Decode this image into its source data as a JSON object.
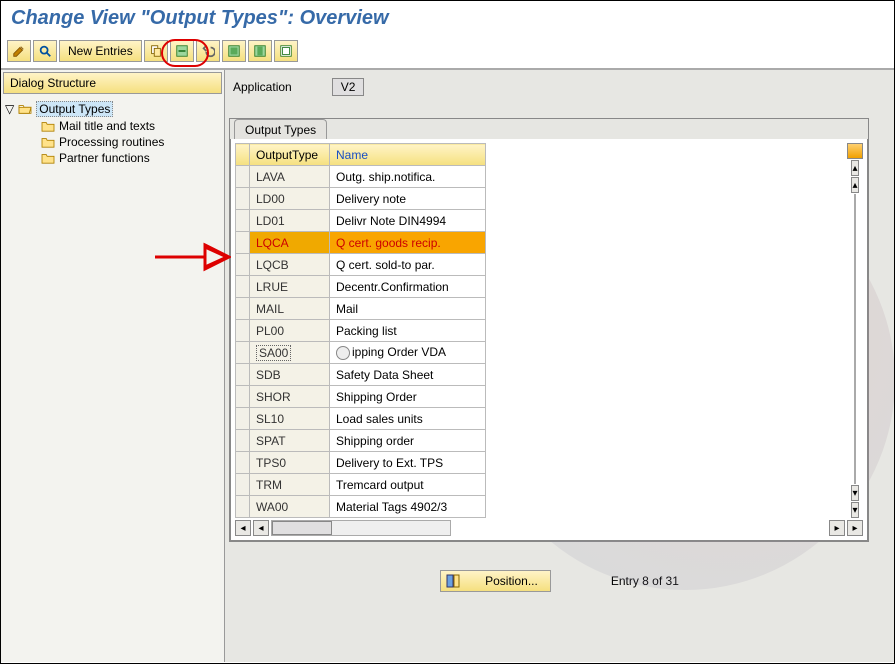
{
  "title": "Change View \"Output Types\": Overview",
  "toolbar": {
    "new_entries": "New Entries"
  },
  "sidebar": {
    "header": "Dialog Structure",
    "root": "Output Types",
    "children": [
      "Mail title and texts",
      "Processing routines",
      "Partner functions"
    ]
  },
  "app": {
    "label": "Application",
    "value": "V2"
  },
  "table": {
    "tab": "Output Types",
    "col1": "OutputType",
    "col2": "Name",
    "rows": [
      {
        "code": "LAVA",
        "name": "Outg. ship.notifica."
      },
      {
        "code": "LD00",
        "name": "Delivery note"
      },
      {
        "code": "LD01",
        "name": "Delivr Note DIN4994"
      },
      {
        "code": "LQCA",
        "name": "Q cert. goods recip.",
        "highlight": true
      },
      {
        "code": "LQCB",
        "name": "Q cert. sold-to par."
      },
      {
        "code": "LRUE",
        "name": "Decentr.Confirmation"
      },
      {
        "code": "MAIL",
        "name": "Mail"
      },
      {
        "code": "PL00",
        "name": "Packing list"
      },
      {
        "code": "SA00",
        "name": "ipping Order VDA",
        "dotted": true,
        "f4": true
      },
      {
        "code": "SDB",
        "name": "Safety Data Sheet"
      },
      {
        "code": "SHOR",
        "name": "Shipping Order"
      },
      {
        "code": "SL10",
        "name": "Load sales units"
      },
      {
        "code": "SPAT",
        "name": "Shipping order"
      },
      {
        "code": "TPS0",
        "name": "Delivery to Ext. TPS"
      },
      {
        "code": "TRM",
        "name": "Tremcard output"
      },
      {
        "code": "WA00",
        "name": "Material Tags 4902/3"
      }
    ]
  },
  "footer": {
    "position": "Position...",
    "status": "Entry 8 of 31"
  }
}
